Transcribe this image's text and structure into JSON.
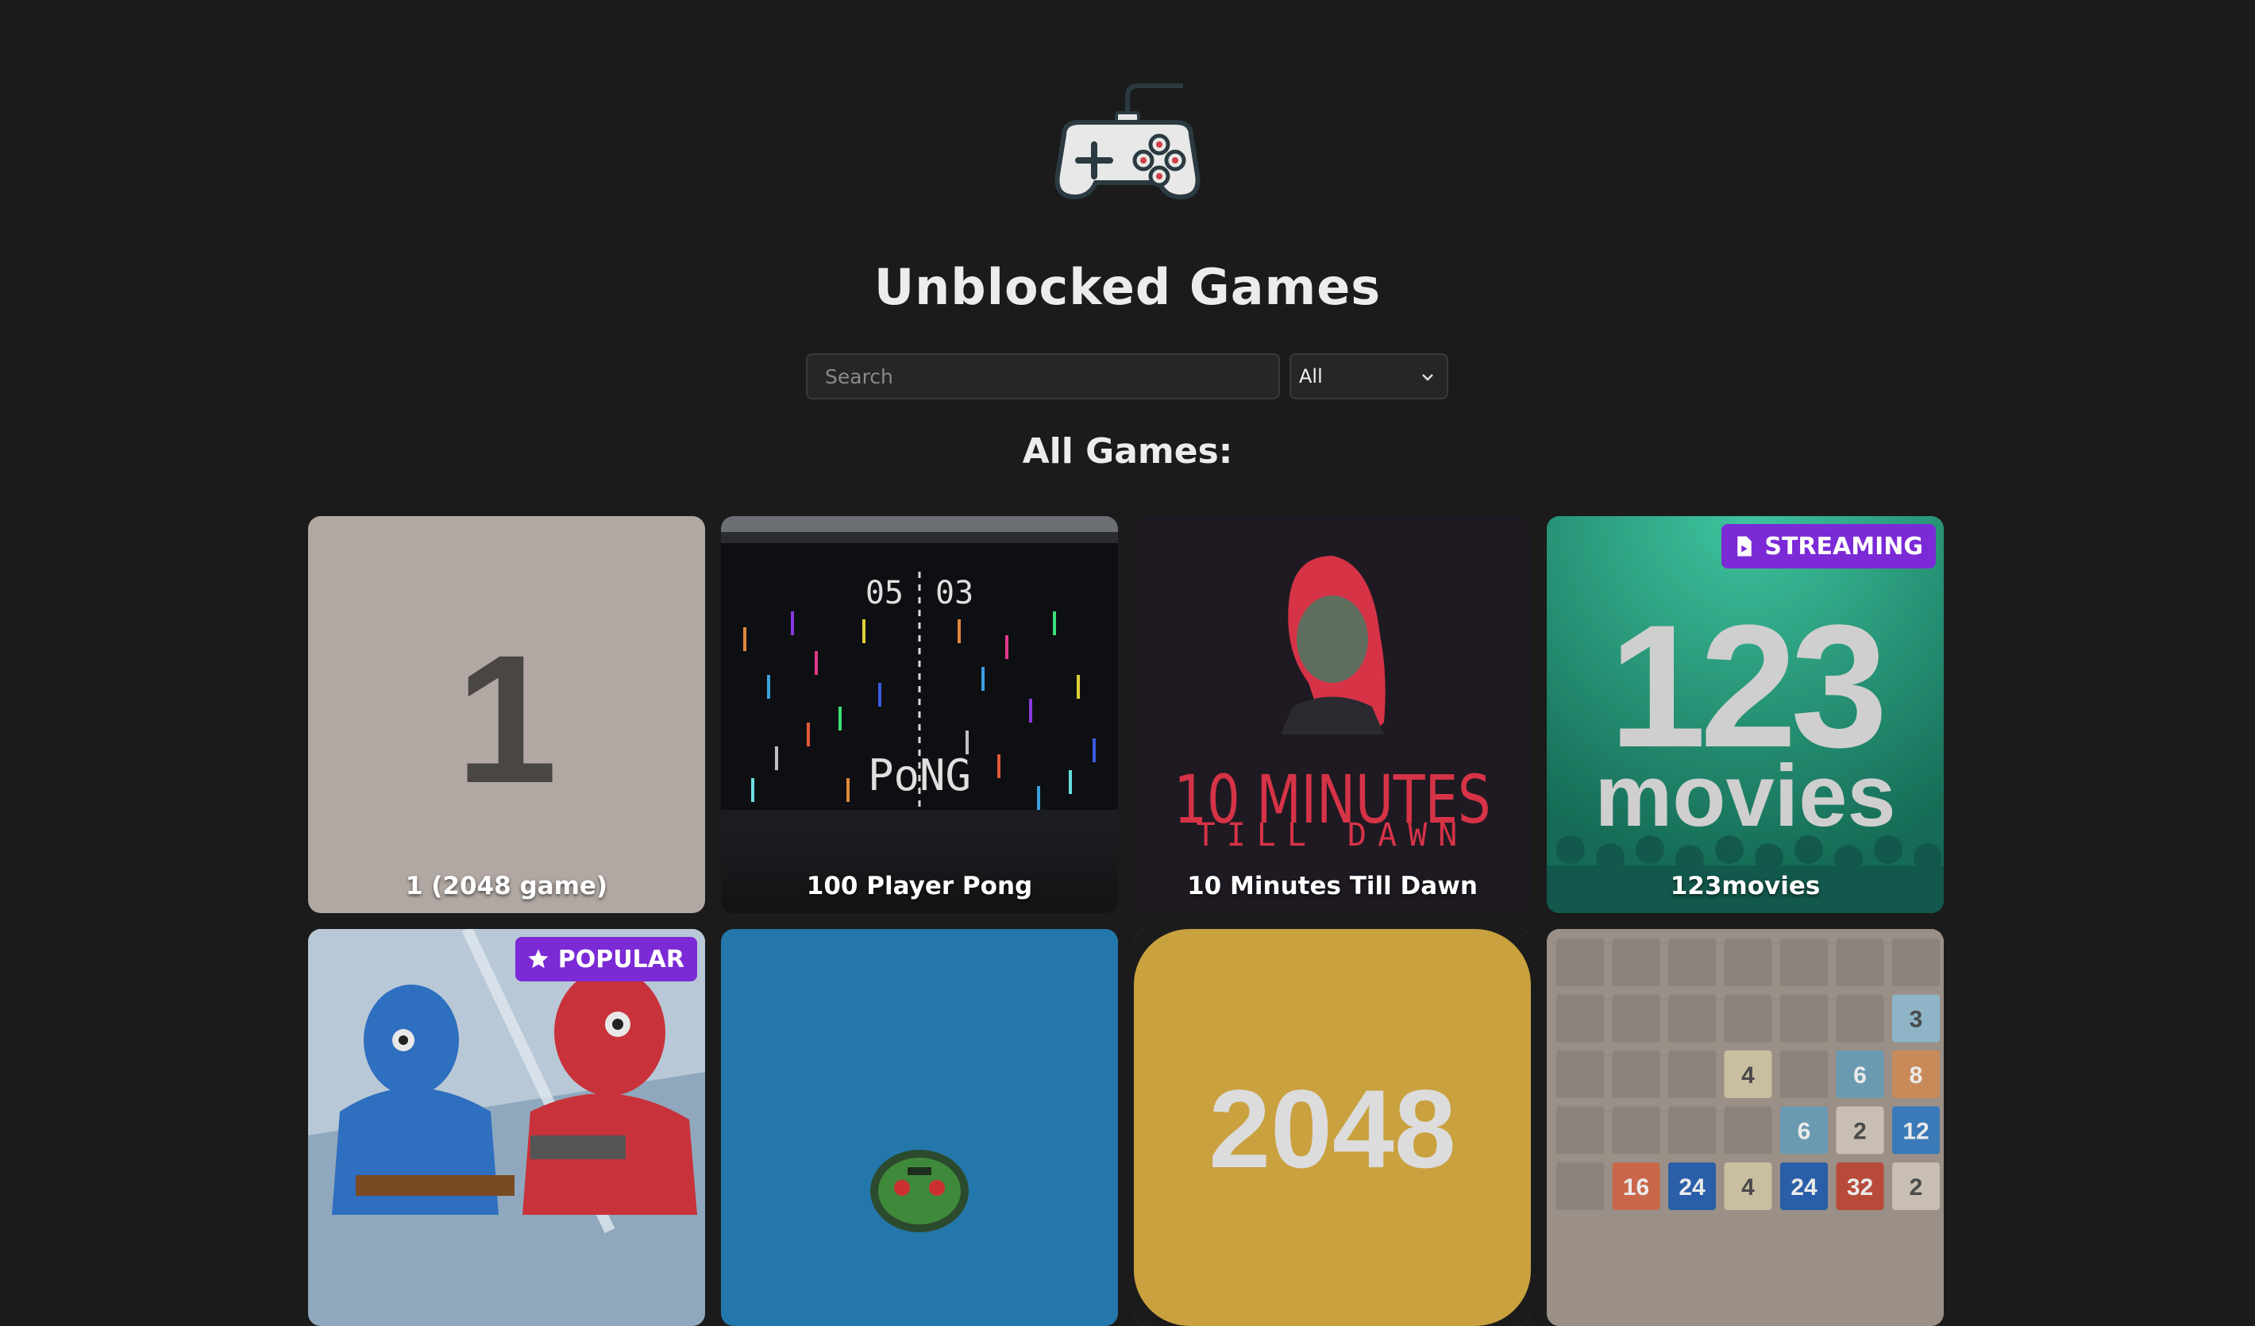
{
  "site": {
    "title": "Unblocked Games"
  },
  "search": {
    "placeholder": "Search"
  },
  "filter": {
    "selected": "All"
  },
  "section": {
    "title": "All Games:"
  },
  "badges": {
    "streaming": "STREAMING",
    "popular": "POPULAR"
  },
  "games": [
    {
      "name": "1 (2048 game)",
      "art_text": "1"
    },
    {
      "name": "100 Player Pong",
      "art_text": "PoNG",
      "score_left": "05",
      "score_right": "03"
    },
    {
      "name": "10 Minutes Till Dawn",
      "art_text": "10 MINUTES",
      "art_subtext": "TILL DAWN"
    },
    {
      "name": "123movies",
      "art_text": "123",
      "art_subtext": "movies"
    },
    {
      "name": ""
    },
    {
      "name": ""
    },
    {
      "name": "",
      "art_text": "2048"
    },
    {
      "name": "",
      "tiles": [
        "3",
        "4",
        "6",
        "8",
        "6",
        "2",
        "12",
        "16",
        "24",
        "4",
        "24",
        "32",
        "2"
      ]
    }
  ],
  "colors": {
    "background": "#1b1b1b",
    "badge": "#7b2ad6",
    "card_1": "#b1a8a3",
    "card_123movies": "#1f9072",
    "card_2048": "#c9a13f"
  }
}
